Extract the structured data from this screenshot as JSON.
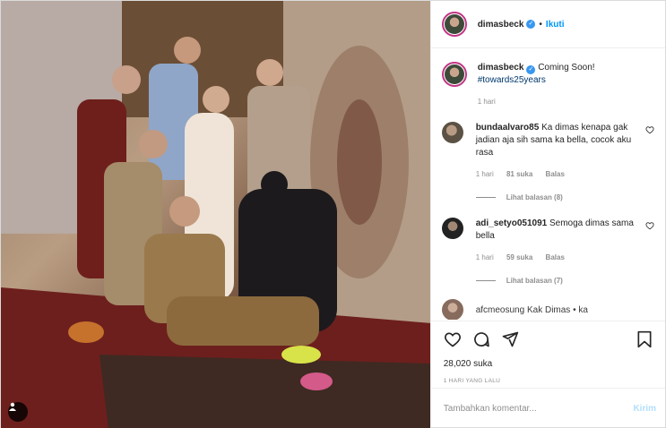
{
  "post": {
    "username": "dimasbeck",
    "follow_label": "Ikuti",
    "dot": "•",
    "caption_text": "Coming Soon!",
    "caption_hashtag": "#towards25years",
    "caption_time": "1 hari",
    "likes": "28,020 suka",
    "posted_ago": "1 HARI YANG LALU",
    "add_comment_placeholder": "Tambahkan komentar...",
    "post_button": "Kirim"
  },
  "comments": [
    {
      "username": "bundaalvaro85",
      "text": "Ka dimas kenapa gak jadian aja sih sama ka bella, cocok aku rasa",
      "time": "1 hari",
      "likes": "81 suka",
      "reply": "Balas",
      "view_replies": "Lihat balasan (8)"
    },
    {
      "username": "adi_setyo051091",
      "text": "Semoga dimas sama bella",
      "time": "1 hari",
      "likes": "59 suka",
      "reply": "Balas",
      "view_replies": "Lihat balasan (7)"
    }
  ],
  "partial_comment": {
    "text": "afcmeosung Kak Dimas • ka"
  },
  "colors": {
    "accent": "#0095f6",
    "verified": "#3897f0",
    "ring": "#c13584",
    "hashtag": "#00376b",
    "muted": "#8e8e8e"
  },
  "icons": [
    "verified-icon",
    "heart-icon",
    "comment-icon",
    "share-icon",
    "bookmark-icon",
    "user-tag-icon"
  ]
}
